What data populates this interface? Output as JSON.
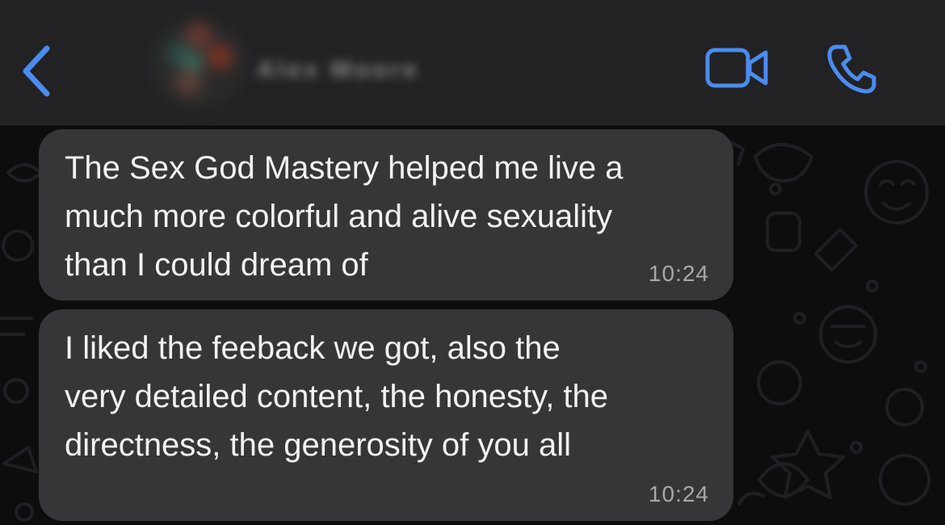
{
  "header": {
    "contact_name": "Alex Moore",
    "back_icon": "chevron-left-icon",
    "video_icon": "video-camera-icon",
    "call_icon": "phone-icon",
    "accent_color": "#4a8cf0"
  },
  "messages": [
    {
      "text": "The Sex God Mastery helped me live a\nmuch more colorful and alive sexuality\nthan I could dream of",
      "time": "10:24"
    },
    {
      "text": "I liked the feeback we got, also the\nvery detailed content, the honesty, the\ndirectness, the generosity of you all",
      "time": "10:24"
    }
  ],
  "colors": {
    "header_bg": "#222224",
    "bubble_bg": "#363638",
    "chat_bg": "#0d0d0e"
  }
}
